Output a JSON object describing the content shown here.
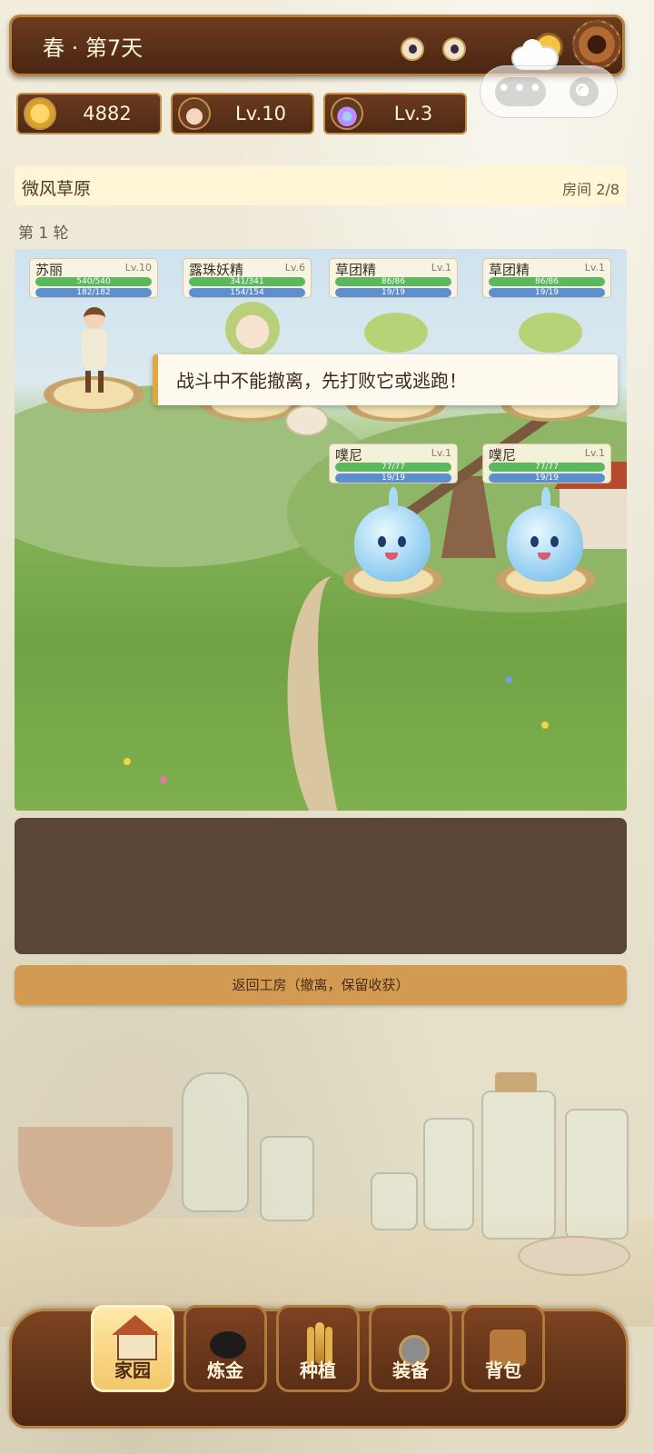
{
  "header": {
    "season": "春",
    "separator": "·",
    "day": "第7天",
    "title": "春 · 第7天"
  },
  "stats": {
    "coins": "4882",
    "player_level": "Lv.10",
    "alchemy_level": "Lv.3"
  },
  "room": {
    "name": "微风草原",
    "progress": "房间 2/8"
  },
  "round_label": "第 1 轮",
  "party": [
    {
      "name": "苏丽",
      "level": "Lv.10",
      "hp": "540/540",
      "mp": "182/182"
    },
    {
      "name": "露珠妖精",
      "level": "Lv.6",
      "hp": "341/341",
      "mp": "154/154"
    },
    {
      "name": "草团精",
      "level": "Lv.1",
      "hp": "86/86",
      "mp": "19/19"
    },
    {
      "name": "草团精",
      "level": "Lv.1",
      "hp": "86/86",
      "mp": "19/19"
    }
  ],
  "enemies": [
    {
      "name": "噗尼",
      "level": "Lv.1",
      "hp": "77/77",
      "mp": "19/19"
    },
    {
      "name": "噗尼",
      "level": "Lv.1",
      "hp": "77/77",
      "mp": "19/19"
    }
  ],
  "toast": "战斗中不能撤离，先打败它或逃跑！",
  "retreat_button": "返回工房（撤离，保留收获）",
  "nav": [
    {
      "label": "家园",
      "icon": "house-icon",
      "active": true
    },
    {
      "label": "炼金",
      "icon": "cauldron-icon",
      "active": false
    },
    {
      "label": "种植",
      "icon": "wheat-icon",
      "active": false
    },
    {
      "label": "装备",
      "icon": "sword-shield-icon",
      "active": false
    },
    {
      "label": "背包",
      "icon": "backpack-icon",
      "active": false
    }
  ],
  "capsule": {
    "more": "•••"
  },
  "colors": {
    "wood_dark": "#4a2612",
    "wood_border": "#b8823d",
    "hp_bar": "#5cb85c",
    "mp_bar": "#5b8fd0",
    "toast_accent": "#e0a845",
    "retreat_button": "#d29a52",
    "log_panel": "#5b4535"
  }
}
